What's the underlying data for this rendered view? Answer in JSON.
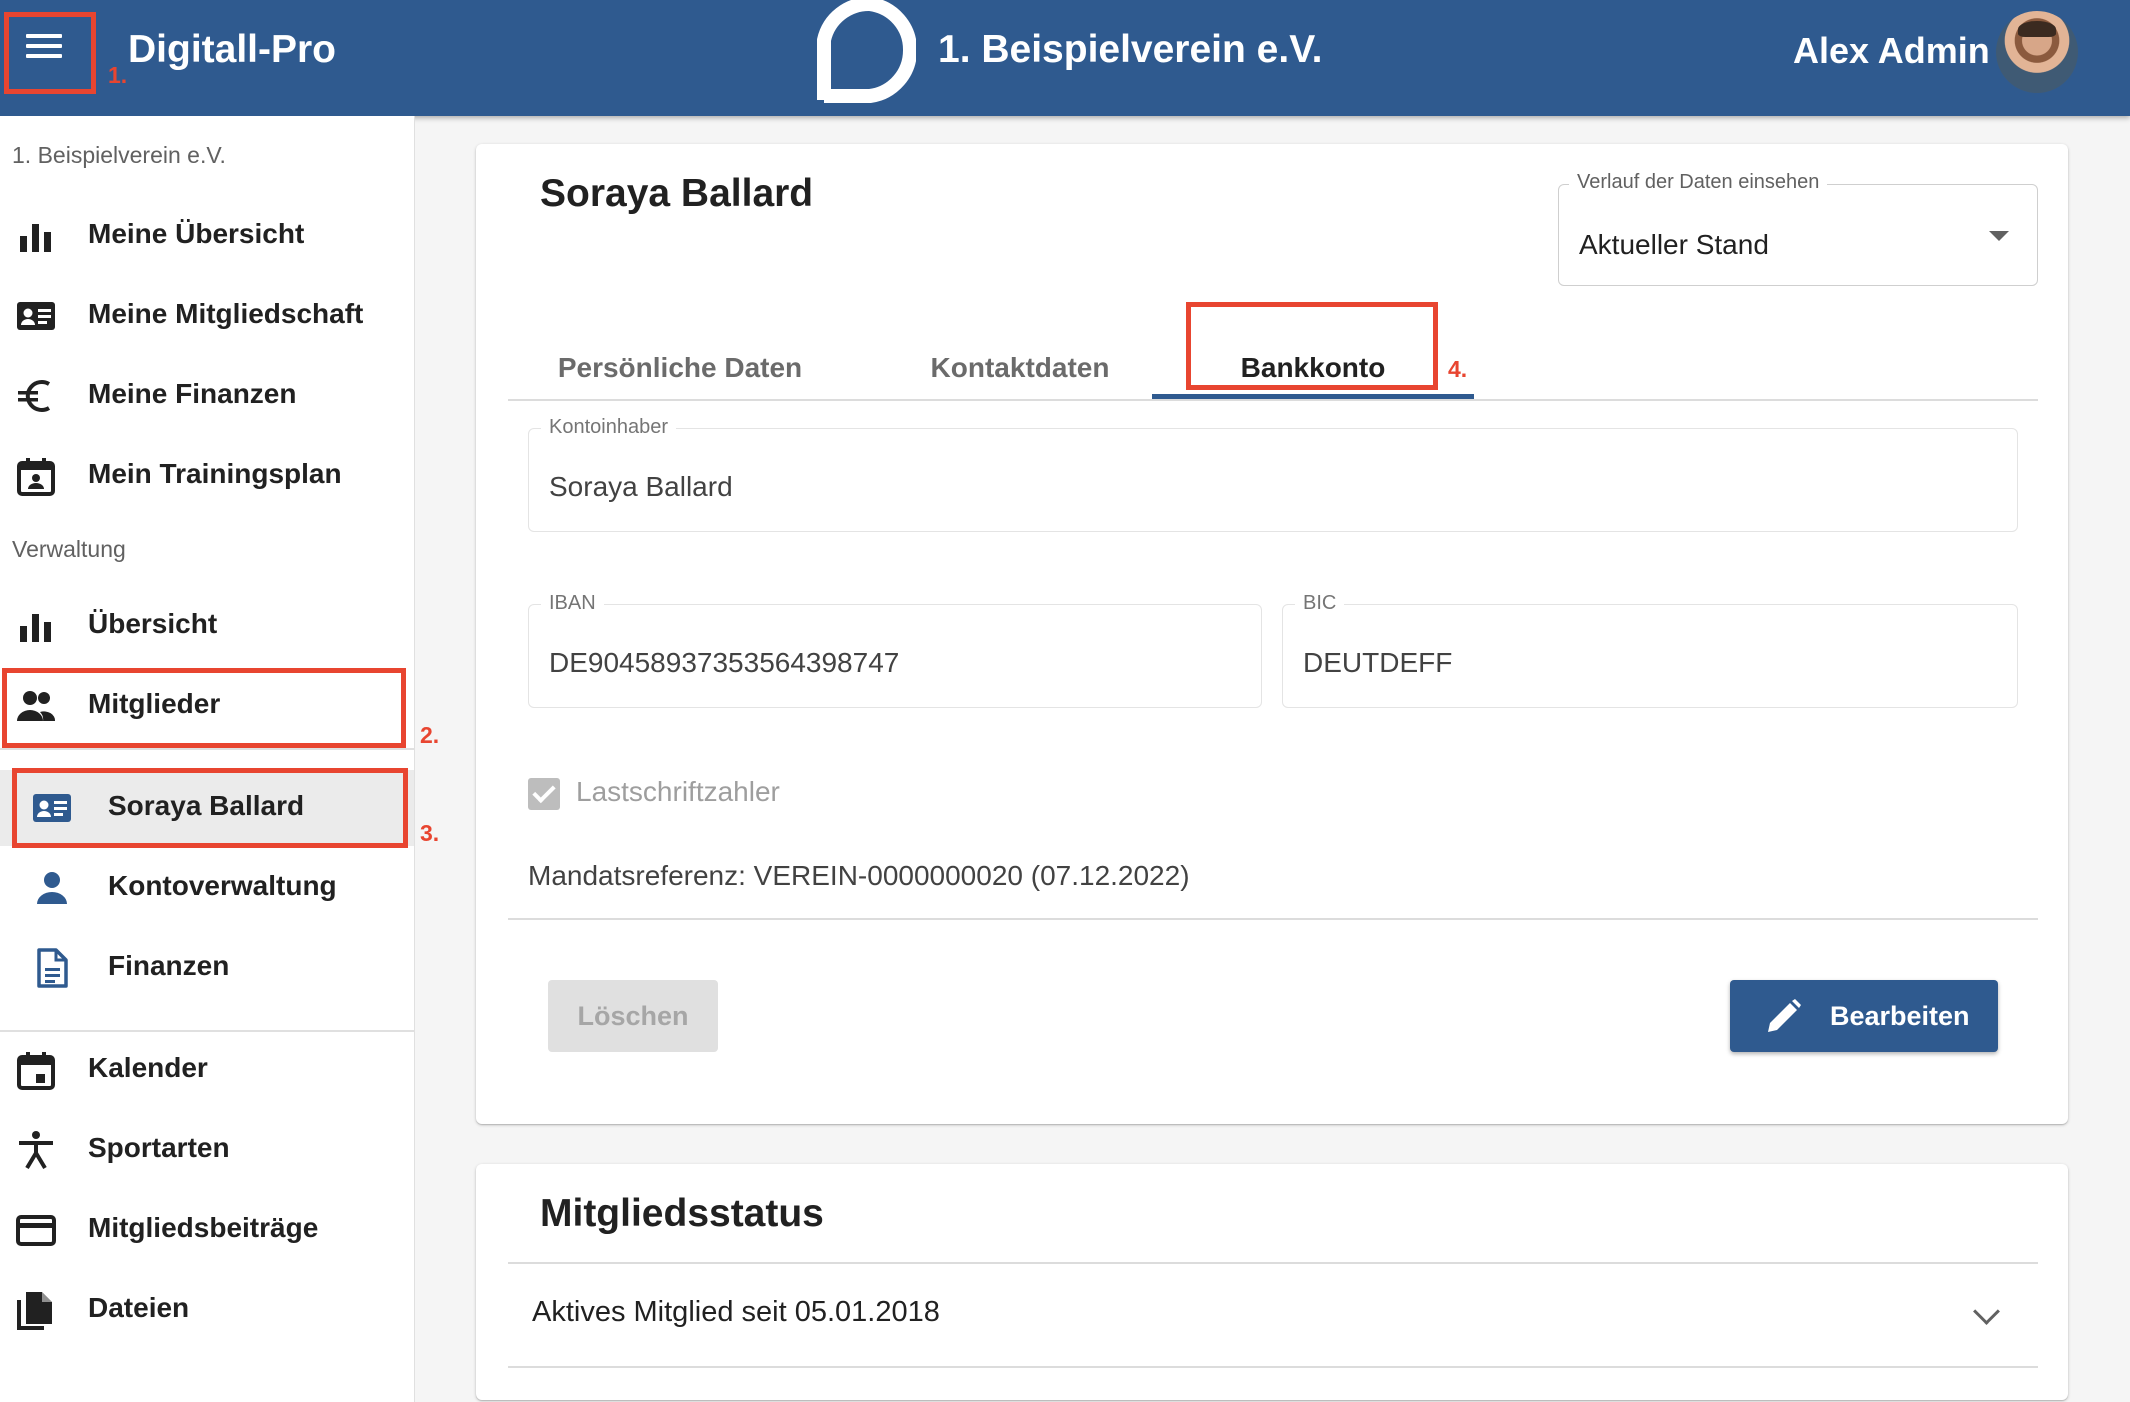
{
  "header": {
    "menu_label": "menu",
    "app_title": "Digitall-Pro",
    "org_title": "1. Beispielverein e.V.",
    "user_name": "Alex Admin"
  },
  "sidebar": {
    "org_section": "1. Beispielverein e.V.",
    "personal_items": [
      {
        "label": "Meine Übersicht",
        "icon": "bar-chart-icon"
      },
      {
        "label": "Meine Mitgliedschaft",
        "icon": "id-card-icon"
      },
      {
        "label": "Meine Finanzen",
        "icon": "euro-icon"
      },
      {
        "label": "Mein Trainingsplan",
        "icon": "calendar-person-icon"
      }
    ],
    "admin_section": "Verwaltung",
    "admin_items": [
      {
        "label": "Übersicht",
        "icon": "bar-chart-icon"
      },
      {
        "label": "Mitglieder",
        "icon": "people-icon"
      }
    ],
    "member_items": [
      {
        "label": "Soraya Ballard",
        "icon": "id-card-icon",
        "active": true
      },
      {
        "label": "Kontoverwaltung",
        "icon": "person-icon"
      },
      {
        "label": "Finanzen",
        "icon": "document-icon"
      }
    ],
    "other_items": [
      {
        "label": "Kalender",
        "icon": "calendar-icon"
      },
      {
        "label": "Sportarten",
        "icon": "sport-icon"
      },
      {
        "label": "Mitgliedsbeiträge",
        "icon": "credit-card-icon"
      },
      {
        "label": "Dateien",
        "icon": "files-icon"
      }
    ]
  },
  "annotations": [
    "1.",
    "2.",
    "3.",
    "4."
  ],
  "member_card": {
    "name": "Soraya Ballard",
    "history": {
      "legend": "Verlauf der Daten einsehen",
      "value": "Aktueller Stand"
    },
    "tabs": [
      "Persönliche Daten",
      "Kontaktdaten",
      "Bankkonto"
    ],
    "active_tab": "Bankkonto",
    "bank": {
      "holder_label": "Kontoinhaber",
      "holder_value": "Soraya Ballard",
      "iban_label": "IBAN",
      "iban_value": "DE90458937353564398747",
      "bic_label": "BIC",
      "bic_value": "DEUTDEFF",
      "direct_debit_label": "Lastschriftzahler",
      "direct_debit_checked": true,
      "mandate": "Mandatsreferenz: VEREIN-0000000020 (07.12.2022)"
    },
    "buttons": {
      "delete": "Löschen",
      "edit": "Bearbeiten"
    }
  },
  "status_card": {
    "title": "Mitgliedsstatus",
    "row": "Aktives Mitglied seit 05.01.2018"
  },
  "colors": {
    "header": "#2f5a8f",
    "accent": "#2f5a8f",
    "annotation": "#e84530"
  }
}
